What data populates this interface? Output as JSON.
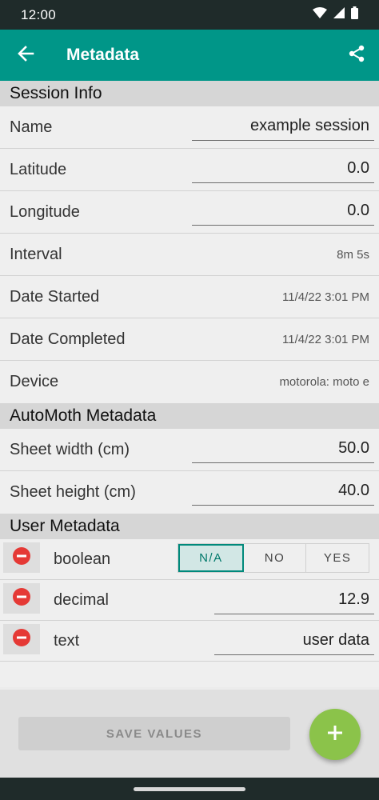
{
  "status_bar": {
    "time": "12:00"
  },
  "app_bar": {
    "title": "Metadata"
  },
  "session_info": {
    "header": "Session Info",
    "name": {
      "label": "Name",
      "value": "example session"
    },
    "latitude": {
      "label": "Latitude",
      "value": "0.0"
    },
    "longitude": {
      "label": "Longitude",
      "value": "0.0"
    },
    "interval": {
      "label": "Interval",
      "value": "8m 5s"
    },
    "date_started": {
      "label": "Date Started",
      "value": "11/4/22 3:01 PM"
    },
    "date_completed": {
      "label": "Date Completed",
      "value": "11/4/22 3:01 PM"
    },
    "device": {
      "label": "Device",
      "value": "motorola: moto e"
    }
  },
  "automoth": {
    "header": "AutoMoth Metadata",
    "sheet_width": {
      "label": "Sheet width (cm)",
      "value": "50.0"
    },
    "sheet_height": {
      "label": "Sheet height (cm)",
      "value": "40.0"
    }
  },
  "user_metadata": {
    "header": "User Metadata",
    "boolean": {
      "label": "boolean",
      "options": [
        "N/A",
        "NO",
        "YES"
      ],
      "selected": "N/A"
    },
    "decimal": {
      "label": "decimal",
      "value": "12.9"
    },
    "text": {
      "label": "text",
      "value": "user data"
    }
  },
  "actions": {
    "save_label": "SAVE VALUES"
  },
  "colors": {
    "app_bar": "#009688",
    "status_bar": "#1f2b2a",
    "fab": "#8bc34a",
    "remove": "#e53935",
    "toggle_selected": "#00897b"
  }
}
